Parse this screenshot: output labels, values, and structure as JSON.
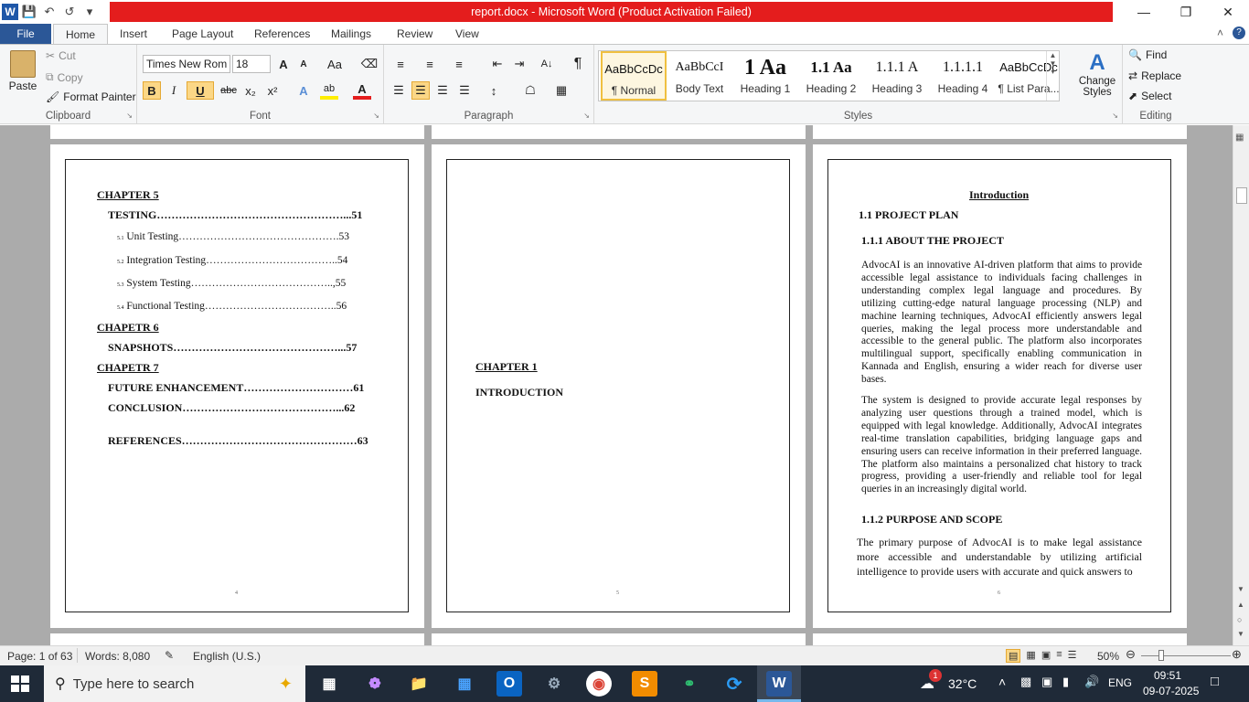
{
  "titlebar": {
    "title": "report.docx  -  Microsoft Word (Product Activation Failed)",
    "app_logo": "W"
  },
  "tabs": [
    "File",
    "Home",
    "Insert",
    "Page Layout",
    "References",
    "Mailings",
    "Review",
    "View"
  ],
  "clipboard": {
    "paste": "Paste",
    "cut": "Cut",
    "copy": "Copy",
    "format_painter": "Format Painter",
    "label": "Clipboard"
  },
  "font": {
    "name": "Times New Rom",
    "size": "18",
    "label": "Font",
    "bold": "B",
    "italic": "I",
    "underline": "U",
    "strike": "abc",
    "sub": "x₂",
    "sup": "x²",
    "grow": "A",
    "shrink": "A",
    "change_case": "Aa"
  },
  "paragraph": {
    "label": "Paragraph",
    "pilcrow": "¶"
  },
  "styles": {
    "label": "Styles",
    "items": [
      {
        "preview": "AaBbCcDc",
        "name": "¶ Normal"
      },
      {
        "preview": "AaBbCcI",
        "name": "Body Text"
      },
      {
        "preview": "1",
        "name": "Heading 1"
      },
      {
        "preview": "Aa",
        "name": ""
      },
      {
        "preview": "1.1",
        "name": "Heading 2"
      },
      {
        "preview": "Aa",
        "name": ""
      },
      {
        "preview": "1.1.1",
        "name": "Heading 3"
      },
      {
        "preview": "A",
        "name": ""
      },
      {
        "preview": "1.1.1.1",
        "name": "Heading 4"
      },
      {
        "preview": "AaBbCcDc",
        "name": "¶ List Para..."
      }
    ],
    "change": "Change Styles"
  },
  "editing": {
    "label": "Editing",
    "find": "Find",
    "replace": "Replace",
    "select": "Select"
  },
  "page4": {
    "lines": [
      {
        "text": "CHAPTER 5"
      },
      {
        "text": "TESTING……………………………………………...51"
      },
      {
        "num": "5.1",
        "text": "Unit Testing……………………………………….53"
      },
      {
        "num": "5.2",
        "text": "Integration Testing………………………………..54"
      },
      {
        "num": "5.3",
        "text": "System Testing…………………………………..,55"
      },
      {
        "num": "5.4",
        "text": "Functional Testing………………………………..56"
      },
      {
        "text": "CHAPETR 6"
      },
      {
        "text": "SNAPSHOTS………………………………………...57"
      },
      {
        "text": "CHAPETR 7"
      },
      {
        "text": "FUTURE ENHANCEMENT…………………………61"
      },
      {
        "text": "CONCLUSION……………………………………...62"
      },
      {
        "text": "REFERENCES…………………………………………63"
      }
    ],
    "page_number": "4"
  },
  "page5": {
    "chapter": "CHAPTER 1",
    "title": "INTRODUCTION",
    "page_number": "5"
  },
  "page6": {
    "heading": "Introduction",
    "h_plan": "1.1 PROJECT PLAN",
    "h_about": "1.1.1  ABOUT THE PROJECT",
    "p1": "AdvocAI is an innovative AI-driven platform that aims to provide accessible legal assistance to individuals facing challenges in understanding complex legal language and procedures. By utilizing cutting-edge natural language processing (NLP) and machine learning techniques, AdvocAI efficiently answers legal queries, making the legal process more understandable and accessible to the general public. The platform also incorporates multilingual support, specifically enabling communication in Kannada and English, ensuring a wider reach for diverse user bases.",
    "p2": "The system is designed to provide accurate legal responses by analyzing user questions through a trained model, which is equipped with legal knowledge. Additionally, AdvocAI integrates real-time translation capabilities, bridging language gaps and ensuring users can receive information in their preferred language. The platform also maintains a personalized chat history to track progress, providing a user-friendly and reliable tool for legal queries in an increasingly digital world.",
    "h_purpose": "1.1.2    PURPOSE AND SCOPE",
    "p3": "The primary purpose of AdvocAI is to make legal assistance more accessible and understandable by utilizing artificial intelligence to provide users with accurate and quick answers to",
    "page_number": "6"
  },
  "status": {
    "page": "Page: 1 of 63",
    "words": "Words: 8,080",
    "language": "English (U.S.)",
    "zoom": "50%"
  },
  "taskbar": {
    "search_placeholder": "Type here to search",
    "temperature": "32°C",
    "lang": "ENG",
    "time": "09:51",
    "date": "09-07-2025",
    "weather_badge": "1"
  }
}
